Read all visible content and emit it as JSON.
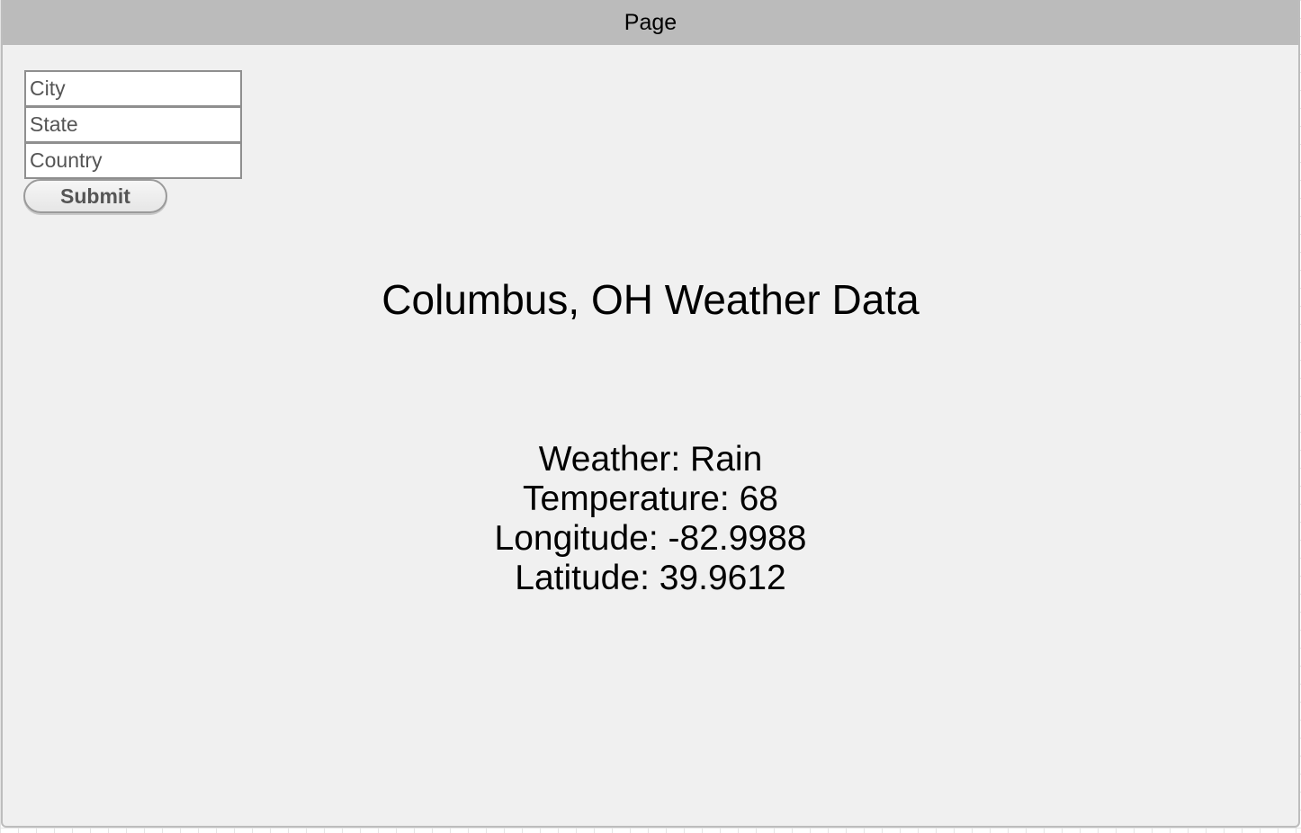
{
  "window": {
    "title": "Page"
  },
  "form": {
    "city_placeholder": "City",
    "state_placeholder": "State",
    "country_placeholder": "Country",
    "submit_label": "Submit"
  },
  "main": {
    "heading": "Columbus, OH Weather Data",
    "weather": "Weather: Rain",
    "temperature": "Temperature: 68",
    "longitude": "Longitude: -82.9988",
    "latitude": "Latitude: 39.9612"
  }
}
